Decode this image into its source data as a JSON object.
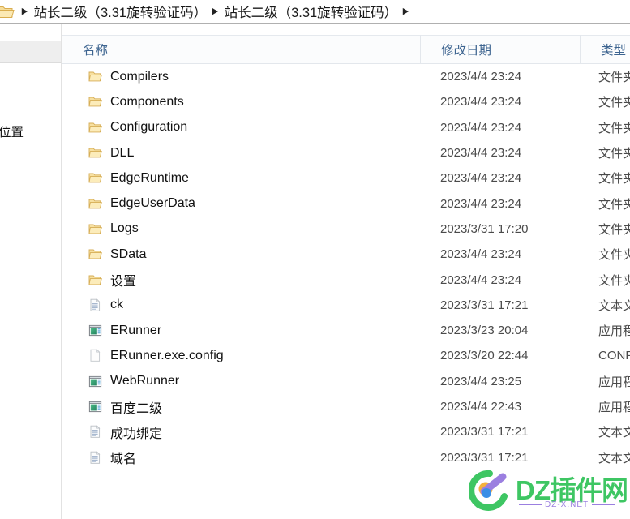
{
  "breadcrumb": {
    "icon": "folder-icon",
    "segments": [
      "站长二级（3.31旋转验证码）",
      "站长二级（3.31旋转验证码）"
    ],
    "separator": "▶",
    "trailing_separator": "▶"
  },
  "sidebar": {
    "label": "位置"
  },
  "columns": {
    "name": "名称",
    "date": "修改日期",
    "type": "类型",
    "sort": {
      "column": "名称",
      "direction": "ascending",
      "icon": "sort-ascending-triangle-icon"
    }
  },
  "rows": [
    {
      "name": "Compilers",
      "date": "2023/4/4 23:24",
      "type": "文件夹",
      "icon": "folder-icon"
    },
    {
      "name": "Components",
      "date": "2023/4/4 23:24",
      "type": "文件夹",
      "icon": "folder-icon"
    },
    {
      "name": "Configuration",
      "date": "2023/4/4 23:24",
      "type": "文件夹",
      "icon": "folder-icon"
    },
    {
      "name": "DLL",
      "date": "2023/4/4 23:24",
      "type": "文件夹",
      "icon": "folder-icon"
    },
    {
      "name": "EdgeRuntime",
      "date": "2023/4/4 23:24",
      "type": "文件夹",
      "icon": "folder-icon"
    },
    {
      "name": "EdgeUserData",
      "date": "2023/4/4 23:24",
      "type": "文件夹",
      "icon": "folder-icon"
    },
    {
      "name": "Logs",
      "date": "2023/3/31 17:20",
      "type": "文件夹",
      "icon": "folder-icon"
    },
    {
      "name": "SData",
      "date": "2023/4/4 23:24",
      "type": "文件夹",
      "icon": "folder-icon"
    },
    {
      "name": "设置",
      "date": "2023/4/4 23:24",
      "type": "文件夹",
      "icon": "folder-icon"
    },
    {
      "name": "ck",
      "date": "2023/3/31 17:21",
      "type": "文本文",
      "icon": "text-file-icon"
    },
    {
      "name": "ERunner",
      "date": "2023/3/23 20:04",
      "type": "应用程",
      "icon": "application-icon"
    },
    {
      "name": "ERunner.exe.config",
      "date": "2023/3/20 22:44",
      "type": "CONFI",
      "icon": "blank-file-icon"
    },
    {
      "name": "WebRunner",
      "date": "2023/4/4 23:25",
      "type": "应用程",
      "icon": "application-icon"
    },
    {
      "name": "百度二级",
      "date": "2023/4/4 22:43",
      "type": "应用程",
      "icon": "application-icon"
    },
    {
      "name": "成功绑定",
      "date": "2023/3/31 17:21",
      "type": "文本文",
      "icon": "text-file-icon"
    },
    {
      "name": "域名",
      "date": "2023/3/31 17:21",
      "type": "文本文",
      "icon": "text-file-icon"
    }
  ],
  "watermark": {
    "text": "DZ插件网",
    "subtitle": "DZ-X.NET",
    "color": "#3ec663",
    "subtitle_color": "#9b7fe0"
  }
}
